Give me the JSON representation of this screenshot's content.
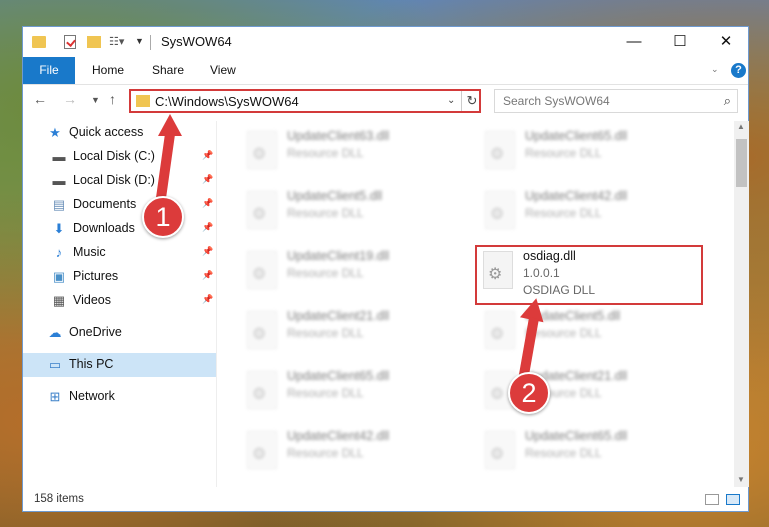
{
  "window": {
    "title": "SysWOW64",
    "minimize_glyph": "—",
    "maximize_glyph": "☐",
    "close_glyph": "✕"
  },
  "ribbon": {
    "tabs": [
      {
        "label": "File"
      },
      {
        "label": "Home"
      },
      {
        "label": "Share"
      },
      {
        "label": "View"
      }
    ],
    "help_glyph": "?"
  },
  "address_bar": {
    "path": "C:\\Windows\\SysWOW64"
  },
  "search": {
    "placeholder": "Search SysWOW64"
  },
  "sidebar": {
    "items": [
      {
        "label": "Quick access",
        "icon": "star-icon"
      },
      {
        "label": "Local Disk (C:)",
        "icon": "drive-icon",
        "pinned": true
      },
      {
        "label": "Local Disk (D:)",
        "icon": "drive-icon",
        "pinned": true
      },
      {
        "label": "Documents",
        "icon": "document-icon",
        "pinned": true
      },
      {
        "label": "Downloads",
        "icon": "download-icon",
        "pinned": true
      },
      {
        "label": "Music",
        "icon": "music-icon",
        "pinned": true
      },
      {
        "label": "Pictures",
        "icon": "picture-icon",
        "pinned": true
      },
      {
        "label": "Videos",
        "icon": "video-icon",
        "pinned": true
      },
      {
        "label": "OneDrive",
        "icon": "cloud-icon"
      },
      {
        "label": "This PC",
        "icon": "computer-icon",
        "selected": true
      },
      {
        "label": "Network",
        "icon": "network-icon"
      }
    ]
  },
  "files": [
    {
      "name": "UpdateClient63.dll",
      "line2": "Resource DLL",
      "line3": "",
      "blurred": true
    },
    {
      "name": "UpdateClient65.dll",
      "line2": "Resource DLL",
      "line3": "",
      "blurred": true
    },
    {
      "name": "UpdateClient5.dll",
      "line2": "Resource DLL",
      "line3": "",
      "blurred": true
    },
    {
      "name": "UpdateClient42.dll",
      "line2": "Resource DLL",
      "line3": "",
      "blurred": true
    },
    {
      "name": "UpdateClient19.dll",
      "line2": "Resource DLL",
      "line3": "",
      "blurred": true
    },
    {
      "name": "osdiag.dll",
      "line2": "1.0.0.1",
      "line3": "OSDIAG DLL",
      "blurred": false,
      "highlighted": true
    },
    {
      "name": "UpdateClient21.dll",
      "line2": "Resource DLL",
      "line3": "",
      "blurred": true
    },
    {
      "name": "UpdateClient5.dll",
      "line2": "Resource DLL",
      "line3": "",
      "blurred": true
    },
    {
      "name": "UpdateClient65.dll",
      "line2": "Resource DLL",
      "line3": "",
      "blurred": true
    },
    {
      "name": "UpdateClient21.dll",
      "line2": "Resource DLL",
      "line3": "",
      "blurred": true
    },
    {
      "name": "UpdateClient42.dll",
      "line2": "Resource DLL",
      "line3": "",
      "blurred": true
    },
    {
      "name": "UpdateClient65.dll",
      "line2": "Resource DLL",
      "line3": "",
      "blurred": true
    }
  ],
  "status": {
    "item_count": "158 items"
  },
  "annotations": {
    "step1": "1",
    "step2": "2",
    "color": "#dc3b3b"
  }
}
